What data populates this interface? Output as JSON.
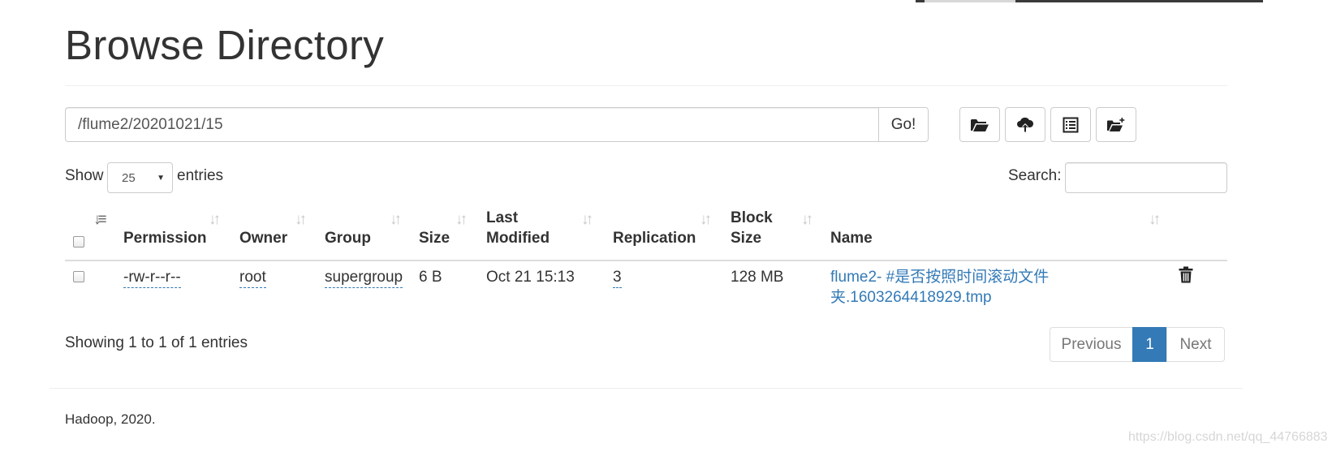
{
  "page": {
    "title": "Browse Directory",
    "footer": "Hadoop, 2020.",
    "watermark": "https://blog.csdn.net/qq_44766883"
  },
  "path_bar": {
    "value": "/flume2/20201021/15",
    "go_label": "Go!"
  },
  "toolbar": {
    "icons": [
      "folder-open-icon",
      "cloud-upload-icon",
      "list-alt-icon",
      "folder-plus-icon"
    ]
  },
  "table_controls": {
    "show_label": "Show",
    "page_length": "25",
    "entries_label": "entries",
    "search_label": "Search:",
    "search_value": ""
  },
  "table": {
    "columns": {
      "permission": "Permission",
      "owner": "Owner",
      "group": "Group",
      "size": "Size",
      "last": "Last",
      "modified": "Modified",
      "replication": "Replication",
      "block": "Block",
      "block_size": "Size",
      "name": "Name"
    },
    "rows": [
      {
        "permission": "-rw-r--r--",
        "owner": "root",
        "group": "supergroup",
        "size": "6 B",
        "last_modified": "Oct 21 15:13",
        "replication": "3",
        "block_size": "128 MB",
        "name_line1": "flume2- #是否按照时间滚动文件",
        "name_line2": "夹.1603264418929.tmp"
      }
    ]
  },
  "pagination": {
    "info": "Showing 1 to 1 of 1 entries",
    "previous": "Previous",
    "current": "1",
    "next": "Next"
  },
  "colors": {
    "link": "#337ab7",
    "active_page": "#337ab7",
    "text": "#333333"
  }
}
